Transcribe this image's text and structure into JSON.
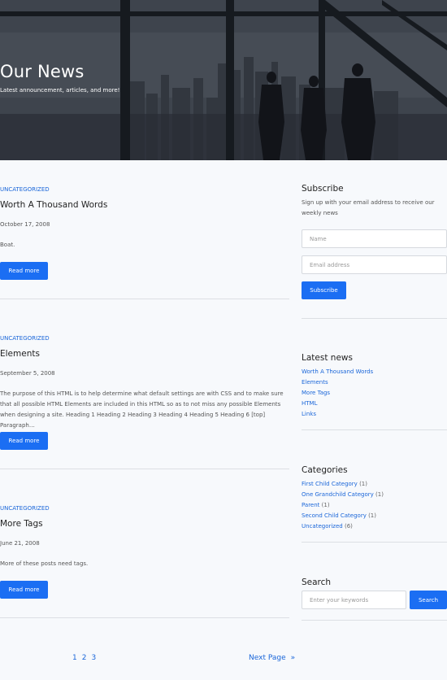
{
  "hero": {
    "title": "Our News",
    "subtitle": "Latest announcement, articles, and more!"
  },
  "posts": [
    {
      "category": "UNCATEGORIZED",
      "title": "Worth A Thousand Words",
      "date": "October 17, 2008",
      "excerpt": "Boat.",
      "button": "Read more"
    },
    {
      "category": "UNCATEGORIZED",
      "title": "Elements",
      "date": "September 5, 2008",
      "excerpt": "The purpose of this HTML is to help determine what default settings are with CSS and to make sure that all possible HTML Elements are included in this HTML so as to not miss any possible Elements when designing a site. Heading 1 Heading 2 Heading 3 Heading 4 Heading 5 Heading 6 [top] Paragraph…",
      "button": "Read more"
    },
    {
      "category": "UNCATEGORIZED",
      "title": "More Tags",
      "date": "June 21, 2008",
      "excerpt": "More of these posts need tags.",
      "button": "Read more"
    }
  ],
  "sidebar": {
    "subscribe": {
      "heading": "Subscribe",
      "description": "Sign up with your email address to receive our weekly news",
      "name_placeholder": "Name",
      "email_placeholder": "Email address",
      "button": "Subscribe"
    },
    "latest_news": {
      "heading": "Latest news",
      "items": [
        "Worth A Thousand Words",
        "Elements",
        "More Tags",
        "HTML",
        "Links"
      ]
    },
    "categories": {
      "heading": "Categories",
      "items": [
        {
          "label": "First Child Category",
          "count": "(1)"
        },
        {
          "label": "One Grandchild Category",
          "count": "(1)"
        },
        {
          "label": "Parent",
          "count": "(1)"
        },
        {
          "label": "Second Child Category",
          "count": "(1)"
        },
        {
          "label": "Uncategorized",
          "count": "(6)"
        }
      ]
    },
    "search": {
      "heading": "Search",
      "placeholder": "Enter your keywords",
      "button": "Search"
    }
  },
  "pagination": {
    "pages": [
      "1",
      "2",
      "3"
    ],
    "next_label": "Next Page",
    "next_arrow": "»"
  },
  "colors": {
    "accent": "#1b6ef3",
    "link": "#1a66d9",
    "background": "#f7f9fc"
  }
}
